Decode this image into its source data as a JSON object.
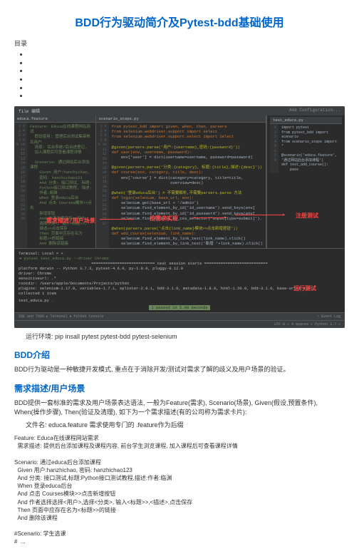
{
  "title": "BDD行为驱动简介及Pytest-bdd基础使用",
  "toc_label": "目录",
  "toc_items": [
    "",
    "",
    "",
    "",
    "",
    ""
  ],
  "ide": {
    "top_left": "file 编辑",
    "top_right": "Add Configuration...",
    "tab1": "educa.feature",
    "tab2": "scenario_steps.py",
    "tab3": "test_educa.py",
    "right_tab": "test_educa.py",
    "gutter_left": "1\n2\n3\n4\n5\n6\n7\n8\n9\n10\n11\n12\n13\n14\n15\n16\n17\n18\n19\n20\n21\n22\n23\n24\n25\n26",
    "gutter_mid": "1\n2\n3\n4\n5\n6\n7\n8\n9\n10\n11\n12\n13\n14\n15\n16\n17\n18\n19\n20\n21\n22\n23\n24\n25\n26\n27",
    "gutter_right": "1\n2\n3\n4\n5\n6\n7\n8",
    "left_code": "Feature: Educa在线课程网站测试\n  假设使用: 管理后台测试集审核及用户\n  场景: 后台系统/后台进登记,\n  加入课程后可查看课程详情\n\n  Scenario: 通过网站后台添加课程\n    Given 用户:hanchichao,\n    密码: hanchichao123\n    And 分类: 接口测试, 标题:\n    Python接口测试教程, 描述:\n    作者:胡渊\n    When 登录educa后台\n    And 点击 Courses模块>>点击\n    新增按钮\n    And 作者选择应用=>用户,\n    选择分类=, 输入=标题>>,\n    描述>>点击保存\n    Then 页面中应存在名为\n    标题>>的链接\n    And 删除该链接",
    "mid_code_lines": [
      {
        "t": "from pytest_bdd import given, when, then, parsers",
        "c": "kw"
      },
      {
        "t": "from selenium.webdriver.support import select",
        "c": "kw"
      },
      {
        "t": "from selenium.webdriver.support.select import Select",
        "c": "kw"
      },
      {
        "t": "",
        "c": ""
      },
      {
        "t": "@given(parsers.parse('用户:{username},密码:{password}'))",
        "c": "dec"
      },
      {
        "t": "def user(env, username, password):",
        "c": "kw"
      },
      {
        "t": "    env['user'] = dict(username=username, password=password)",
        "c": ""
      },
      {
        "t": "",
        "c": ""
      },
      {
        "t": "@given(parsers.parse('分类:{category}, 标题:{title},描述:{desc}'))",
        "c": "dec"
      },
      {
        "t": "def course(env, category, title, desc):",
        "c": "kw"
      },
      {
        "t": "    env['course'] = dict(category=category, title=title,",
        "c": ""
      },
      {
        "t": "                         overview=desc)",
        "c": ""
      },
      {
        "t": "",
        "c": ""
      },
      {
        "t": "@when('登录educa后台') # 不需要解析,不需要parsers.parse 方法",
        "c": "dec"
      },
      {
        "t": "def login(selenium, base_url, env):",
        "c": "kw"
      },
      {
        "t": "    selenium.get(base_url + '/admin')",
        "c": ""
      },
      {
        "t": "    selenium.find_element_by_id('id_username').send_keys(env[",
        "c": ""
      },
      {
        "t": "    selenium.find_element_by_id('id_password').send_keys(env[",
        "c": ""
      },
      {
        "t": "    selenium.find_element_by_css_selector('input[type=submit]').",
        "c": ""
      },
      {
        "t": "",
        "c": ""
      },
      {
        "t": "@when(parsers.parse('点击{link_name}模块>>点击新增按钮'))",
        "c": "dec"
      },
      {
        "t": "def add_course(selenium, link_name):",
        "c": "kw"
      },
      {
        "t": "    selenium.find_element_by_link_text(link_name).click()",
        "c": ""
      },
      {
        "t": "    selenium.find_element_by_link_text('新增 '+link_name).click()",
        "c": ""
      }
    ],
    "right_code": "import pytest\nfrom pytest_bdd import scenario\nfrom scenario_steps import *\n\n@scenario('educa.feature', '通过网站后台添加课程')\ndef test_add_course():\n    pass",
    "ann_left": "需求描述/用户场景",
    "ann_mid": "按需求实现",
    "ann_right": "注册测试",
    "ann_run": "运行测试"
  },
  "terminal": {
    "header": "Terminal:   Local  ×  +",
    "cmd": "pytest test_educa.py --driver Chrome",
    "session": "=========================== test session starts ===========================",
    "platform": "platform darwin -- Python 3.7.3, pytest-4.6.0, py-1.8.0, pluggy-0.12.0",
    "driver": "driver: Chrome",
    "sens": "sensitiveurl: .*",
    "rootdir": "rootdir: /Users/apple/Documents/Projects/python",
    "plugins": "plugins: selenium-1.17.0, variables-1.7.1, splinter-2.0.1, bdd-3.1.0, metadata-1.8.0, html-1.20.0, bdd-3.1.0, base-url-1.4.1",
    "collected": "collected 1 item",
    "file": "test_educa.py ",
    "dot": ".",
    "passed": "1 passed in 5.08 seconds"
  },
  "status": {
    "left": "  IDE and TODO   ▸ Terminal   ♦ Python Console",
    "right": "○ Event Log",
    "info": "UTF-8  ÷  4 spaces  ÷  Python 3.7  ÷"
  },
  "run_env_label": "运行环境: pip insall pytest pytest-bdd pytest-selenium",
  "bdd_intro_h": "BDD介绍",
  "bdd_intro_p": "BDD行为驱动是一种敏捷开发模式, 重点在于消除开发/测试对需求了解的歧义及用户场景的验证。",
  "scene_h": "需求描述/用户场景",
  "scene_p1": "BDD提供一套标准的需求及用户场景表达语法, 一般为Feature(需求), Scenario(场景), Given(假设,预置条件), When(操作步骤), Then(验证及清理), 如下为一个需求描述(有的公司称为需求卡片):",
  "file_line": "文件名: educa.feature 需求使用专门的 .feature作为后缀",
  "feature_text": "Feature: Educa在线课程网站需求\n  需求描述: 提供后台添加课程及课程内容, 前台学生浏览课程, 加入课程后可查看课程详情\n\nScenario: 通过educa后台添加课程\n  Given 用户:hanzhichao, 密码: hanzhichao123\n  And 分类: 接口测试,标题:Python接口测试教程,描述:作者:临渊\n  When 登录educa后台\n  And 点击 Courses模块>>点击新增按钮\n  And 作者选择选择<用户>,选择<分类>, 输入<标题>>,<描述>,点击保存\n  Then 页面中应存在名为<标题>>的链接\n  And 删除该课程\n\n#Scenario: 学生选课\n#  ..."
}
